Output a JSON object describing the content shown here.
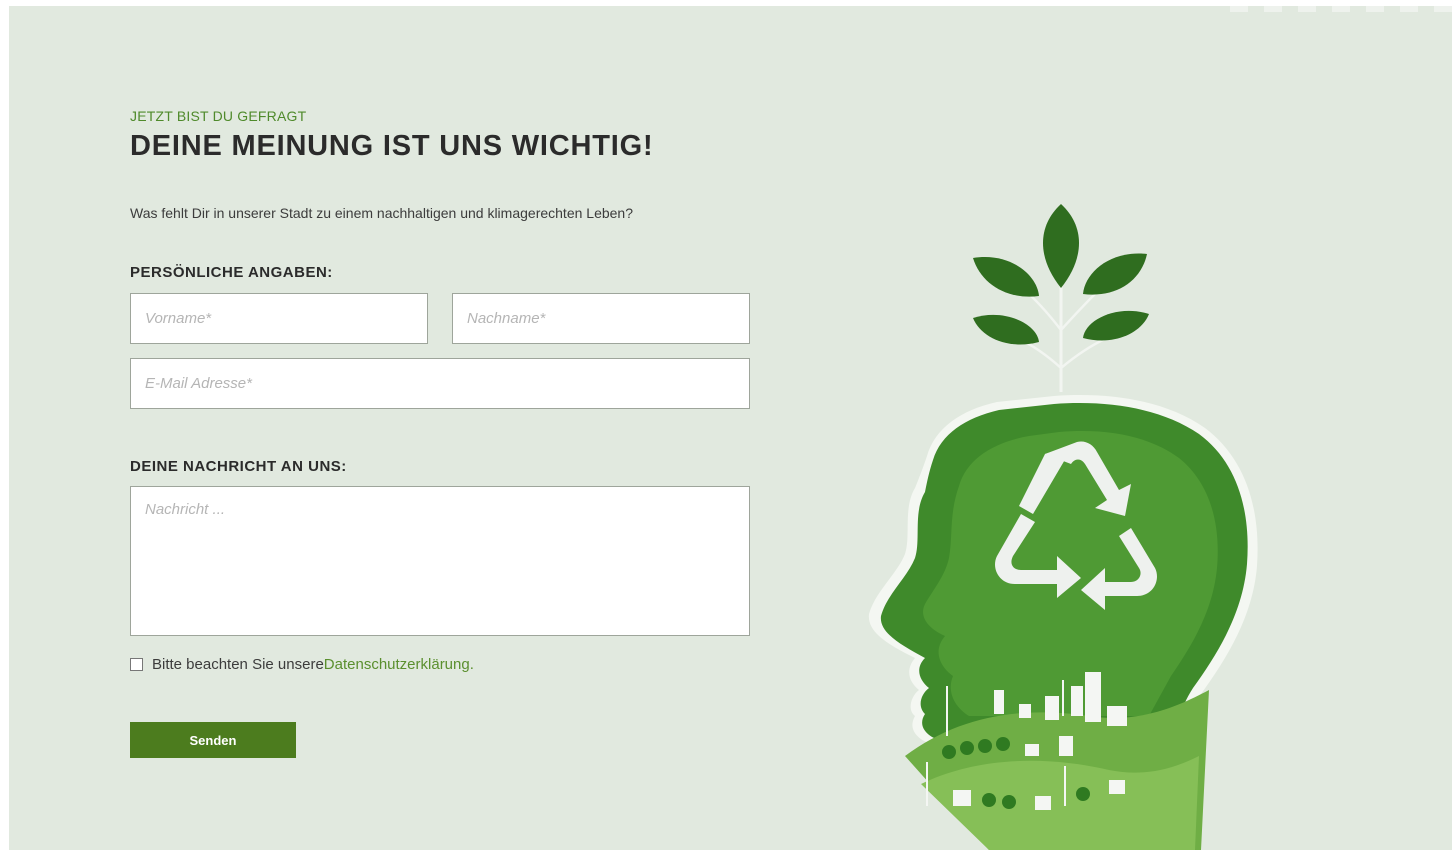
{
  "form": {
    "eyebrow": "JETZT BIST DU GEFRAGT",
    "headline": "DEINE MEINUNG IST UNS WICHTIG!",
    "intro": "Was fehlt Dir in unserer Stadt zu einem nachhaltigen und klimagerechten Leben?",
    "personal_section_label": "PERSÖNLICHE ANGABEN:",
    "firstname": {
      "placeholder": "Vorname*",
      "value": ""
    },
    "lastname": {
      "placeholder": "Nachname*",
      "value": ""
    },
    "email": {
      "placeholder": "E-Mail Adresse*",
      "value": ""
    },
    "message_section_label": "DEINE NACHRICHT AN UNS:",
    "message": {
      "placeholder": "Nachricht ...",
      "value": ""
    },
    "consent": {
      "checked": false,
      "text": "Bitte beachten Sie unsere ",
      "link_label": "Datenschutzerklärung",
      "suffix": "."
    },
    "submit_label": "Senden"
  },
  "illustration": {
    "icon": "recycle-icon",
    "colors": {
      "background": "#e1e9df",
      "green_dark": "#2f6d1f",
      "green_mid": "#3f8a2b",
      "green_light": "#6fae45",
      "accent": "#4c7c1e",
      "link": "#5a8f2e"
    }
  }
}
